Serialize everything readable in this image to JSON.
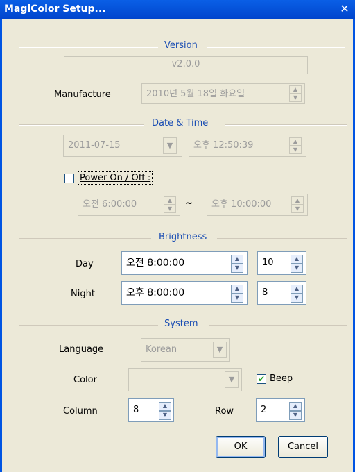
{
  "window": {
    "title": "MagiColor Setup...",
    "close": "✕"
  },
  "version": {
    "section": "Version",
    "value": "v2.0.0",
    "manufacture_label": "Manufacture",
    "manufacture_value": "2010년  5월 18일 화요일"
  },
  "datetime": {
    "section": "Date & Time",
    "date_value": "2011-07-15",
    "time_value": "오후 12:50:39",
    "power_label": "Power On / Off :",
    "power_checked": false,
    "on_time": "오전  6:00:00",
    "tilde": "~",
    "off_time": "오후 10:00:00"
  },
  "brightness": {
    "section": "Brightness",
    "day_label": "Day",
    "day_time": "오전  8:00:00",
    "day_value": "10",
    "night_label": "Night",
    "night_time": "오후  8:00:00",
    "night_value": "8"
  },
  "system": {
    "section": "System",
    "language_label": "Language",
    "language_value": "Korean",
    "color_label": "Color",
    "color_value": "",
    "beep_label": "Beep",
    "beep_checked": true,
    "column_label": "Column",
    "column_value": "8",
    "row_label": "Row",
    "row_value": "2"
  },
  "buttons": {
    "ok": "OK",
    "cancel": "Cancel"
  }
}
